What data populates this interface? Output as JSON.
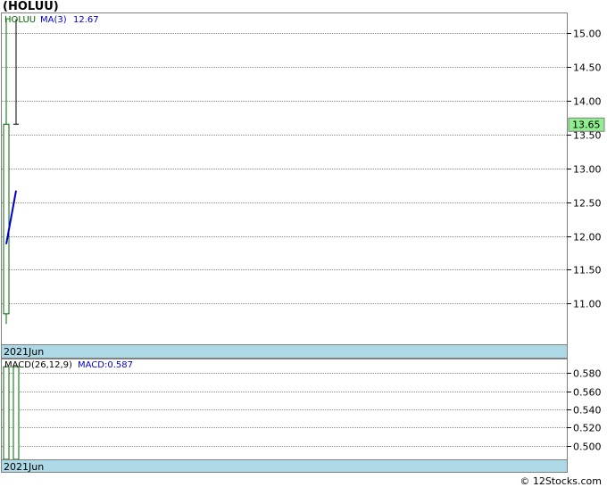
{
  "title": "(HOLUU)",
  "watermark": "© 12Stocks.com",
  "colors": {
    "grid": "#888888",
    "axisBand": "#add8e6",
    "candle": "#006400",
    "ma": "#0000cc",
    "priceTag": "#90ee90"
  },
  "chart_data": [
    {
      "type": "candlestick",
      "title": "",
      "ticker_label": "HOLUU",
      "indicator_label": "MA(3)",
      "indicator_value": "12.67",
      "last_price_label": "13.65",
      "x_label": "2021Jun",
      "ylim": [
        10.4,
        15.3
      ],
      "yticks": [
        11.0,
        11.5,
        12.0,
        12.5,
        13.0,
        13.5,
        14.0,
        14.5,
        15.0
      ],
      "ytick_labels": [
        "11.00",
        "11.50",
        "12.00",
        "12.50",
        "13.00",
        "13.50",
        "14.00",
        "14.50",
        "15.00"
      ],
      "candles": [
        {
          "index": 0,
          "open": 10.85,
          "high": 15.2,
          "low": 10.7,
          "close": 13.65
        },
        {
          "index": 1,
          "open": 13.65,
          "high": 15.2,
          "low": 13.65,
          "close": 13.65
        }
      ],
      "ma_line": [
        {
          "index": 0,
          "value": 11.88
        },
        {
          "index": 1,
          "value": 12.67
        }
      ],
      "last_price": 13.65
    },
    {
      "type": "bar",
      "title": "",
      "indicator_label": "MACD(26,12,9)",
      "indicator_value_label": "MACD:0.587",
      "x_label": "2021Jun",
      "ylim": [
        0.485,
        0.595
      ],
      "yticks": [
        0.5,
        0.52,
        0.54,
        0.56,
        0.58
      ],
      "ytick_labels": [
        "0.500",
        "0.520",
        "0.540",
        "0.560",
        "0.580"
      ],
      "bars": [
        {
          "index": 0,
          "value": 0.587
        },
        {
          "index": 1,
          "value": 0.587
        }
      ]
    }
  ]
}
